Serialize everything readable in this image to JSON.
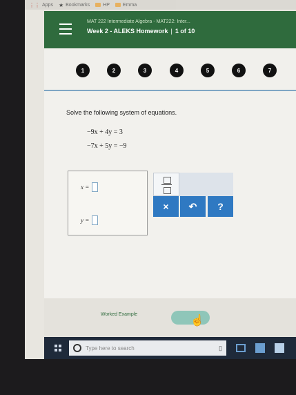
{
  "browser": {
    "bookmarks": [
      {
        "label": "Apps",
        "icon": "apps-grid-icon"
      },
      {
        "label": "Bookmarks",
        "icon": "star-icon"
      },
      {
        "label": "HP",
        "icon": "folder-icon"
      },
      {
        "label": "Emma",
        "icon": "folder-icon"
      }
    ]
  },
  "header": {
    "course_title": "MAT 222 Intermediate Algebra - MAT222: Inter...",
    "assignment": "Week 2 - ALEKS Homework",
    "separator": "|",
    "position": "1 of 10",
    "menu_icon": "hamburger-menu-icon"
  },
  "progress": {
    "questions": [
      "1",
      "2",
      "3",
      "4",
      "5",
      "6",
      "7"
    ]
  },
  "problem": {
    "prompt": "Solve the following system of equations.",
    "equations": [
      "−9x + 4y = 3",
      "−7x + 5y = −9"
    ]
  },
  "answer": {
    "x_label": "x =",
    "y_label": "y ="
  },
  "palette": {
    "fraction_icon": "fraction-icon",
    "clear_label": "×",
    "undo_icon": "undo-arrow-icon",
    "help_label": "?"
  },
  "footer": {
    "worked_example": "Worked Example"
  },
  "taskbar": {
    "search_placeholder": "Type here to search"
  },
  "colors": {
    "header_green": "#2f6b3d",
    "button_blue": "#2f79c2",
    "check_teal": "#8fc6b9"
  }
}
